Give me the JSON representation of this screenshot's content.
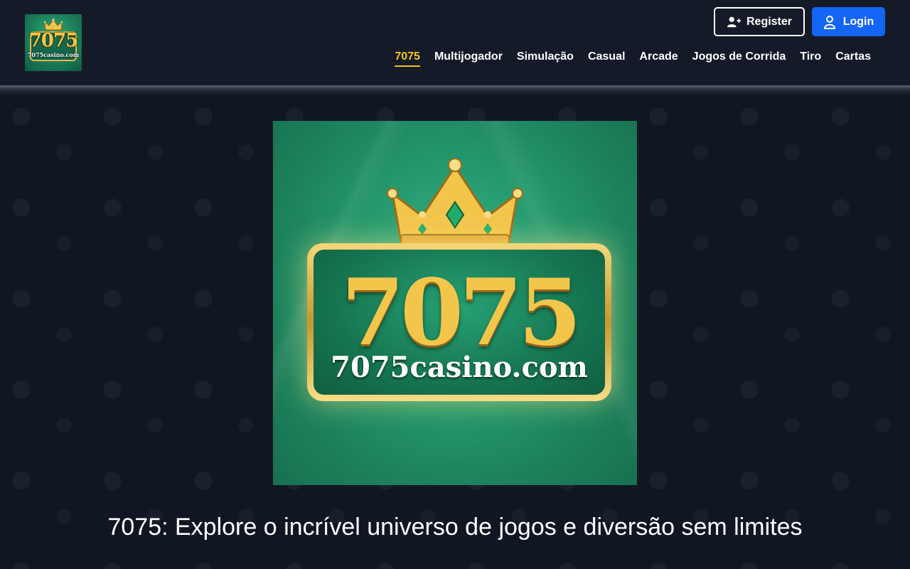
{
  "header": {
    "logo": {
      "number": "7075",
      "domain": "7075casino.com",
      "icon": "crown-icon"
    },
    "buttons": {
      "register_label": "Register",
      "register_icon": "user-plus-icon",
      "login_label": "Login",
      "login_icon": "user-icon"
    },
    "nav": [
      {
        "label": "7075",
        "active": true
      },
      {
        "label": "Multijogador",
        "active": false
      },
      {
        "label": "Simulação",
        "active": false
      },
      {
        "label": "Casual",
        "active": false
      },
      {
        "label": "Arcade",
        "active": false
      },
      {
        "label": "Jogos de Corrida",
        "active": false
      },
      {
        "label": "Tiro",
        "active": false
      },
      {
        "label": "Cartas",
        "active": false
      }
    ]
  },
  "hero": {
    "number": "7075",
    "domain": "7075casino.com",
    "icon": "crown-icon"
  },
  "main": {
    "headline": "7075: Explore o incrível universo de jogos e diversão sem limites"
  },
  "colors": {
    "background": "#111722",
    "header": "#141a27",
    "accent_active": "#f5c518",
    "login_button": "#1565f5",
    "brand_green": "#1f8a62",
    "brand_gold": "#f2c64b"
  }
}
